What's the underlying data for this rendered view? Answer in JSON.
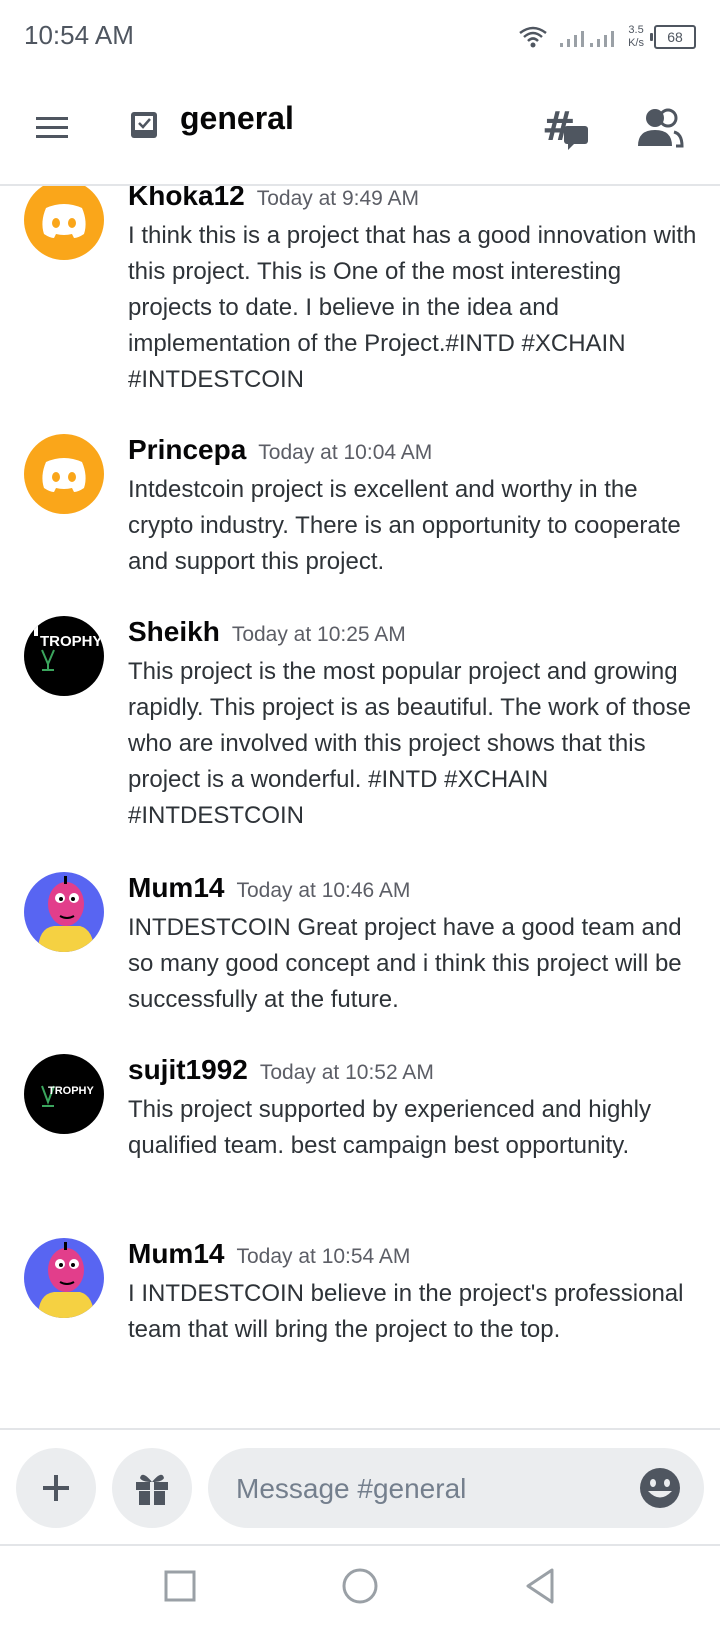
{
  "status_bar": {
    "time": "10:54 AM",
    "net_speed_value": "3.5",
    "net_speed_unit": "K/s",
    "battery": "68"
  },
  "header": {
    "channel_name": "general",
    "icons": [
      "hamburger-menu-icon",
      "channel-icon",
      "threads-icon",
      "members-icon"
    ]
  },
  "messages": [
    {
      "username": "Khoka12",
      "timestamp": "Today at 9:49 AM",
      "avatar": "discord-logo-avatar",
      "text": "I think this is a project that has a good innovation with this project. This is One of the most interesting projects to date. I believe in the idea and implementation of the Project.#INTD #XCHAIN  #INTDESTCOIN"
    },
    {
      "username": "Princepa",
      "timestamp": "Today at 10:04 AM",
      "avatar": "discord-logo-avatar",
      "text": "Intdestcoin project is excellent and worthy in the crypto industry. There is an opportunity to cooperate and support this project."
    },
    {
      "username": "Sheikh",
      "timestamp": "Today at 10:25 AM",
      "avatar": "trophy-avatar",
      "avatar_text": "TROPHY",
      "text": "This project is the most popular project and growing rapidly. This project is as beautiful. The work of those who are involved with this project shows that this project is a wonderful. #INTD #XCHAIN  #INTDESTCOIN"
    },
    {
      "username": "Mum14",
      "timestamp": "Today at 10:46 AM",
      "avatar": "cartoon-avatar",
      "text": "INTDESTCOIN Great project have a good team and so many good concept and i think this project will be successfully at the future."
    },
    {
      "username": "sujit1992",
      "timestamp": "Today at 10:52 AM",
      "avatar": "trophy-avatar",
      "avatar_text": "TROPHY",
      "text": "This project supported by experienced and highly qualified team. best campaign best opportunity."
    },
    {
      "username": "Mum14",
      "timestamp": "Today at 10:54 AM",
      "avatar": "cartoon-avatar",
      "text": "I  INTDESTCOIN believe in the project's professional team that will bring the project to the top."
    }
  ],
  "composer": {
    "placeholder": "Message #general",
    "icons": [
      "plus-icon",
      "gift-icon",
      "emoji-icon"
    ]
  },
  "nav_bar": {
    "icons": [
      "recents-square-icon",
      "home-circle-icon",
      "back-triangle-icon"
    ]
  },
  "colors": {
    "discord_avatar_bg": "#faa61a",
    "cartoon_avatar_bg": "#5865f2",
    "trophy_avatar_bg": "#000000",
    "input_bg": "#ebedef"
  }
}
